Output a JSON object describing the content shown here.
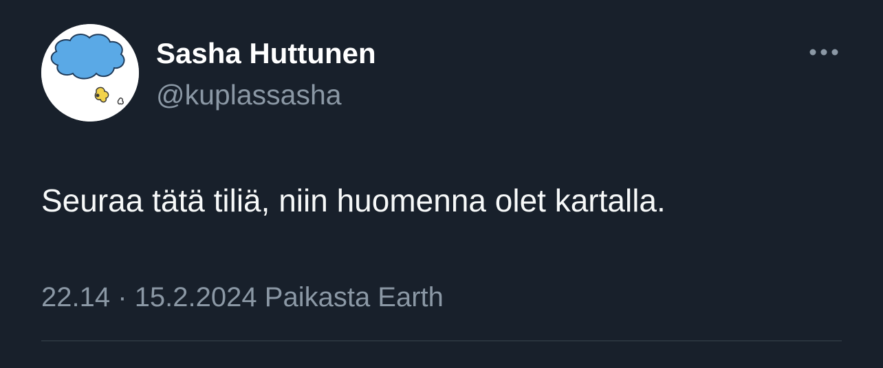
{
  "tweet": {
    "author": {
      "display_name": "Sasha Huttunen",
      "handle": "@kuplassasha",
      "avatar_icon": "cloud-avatar-icon"
    },
    "more_icon": "more-options-icon",
    "text": "Seuraa tätä tiliä, niin huomenna olet kartalla.",
    "meta": {
      "time": "22.14",
      "separator": "·",
      "date": "15.2.2024",
      "location": "Paikasta Earth"
    }
  },
  "colors": {
    "background": "#18202b",
    "primary_text": "#f7f9f9",
    "secondary_text": "#8b98a5",
    "divider": "#38444d",
    "avatar_cloud": "#5aa9e6",
    "avatar_blob": "#f2d24b"
  }
}
